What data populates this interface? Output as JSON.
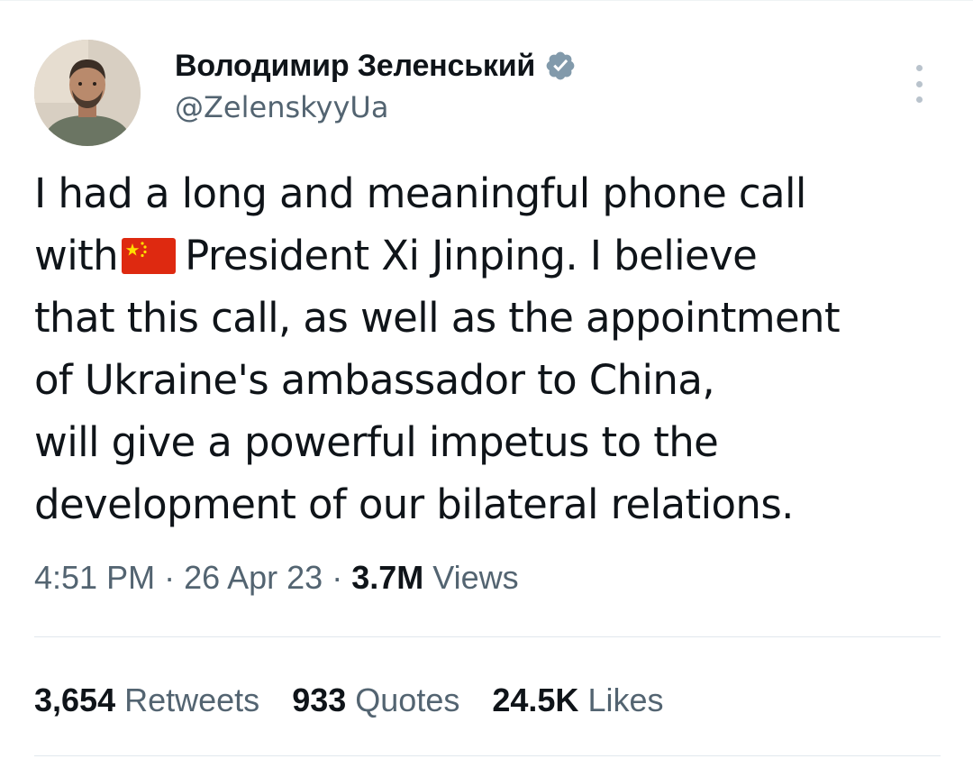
{
  "author": {
    "name": "Володимир Зеленський",
    "handle": "@ZelenskyyUa",
    "verified": true,
    "avatar_icon": "profile-photo",
    "verified_icon": "verified-badge-icon"
  },
  "menu": {
    "icon": "more-vertical-icon"
  },
  "tweet": {
    "lines": [
      {
        "text": "I had a long and meaningful phone call"
      },
      {
        "prefix": "with",
        "emoji": "china-flag",
        "suffix": "President Xi Jinping. I believe"
      },
      {
        "text": "that this call, as well as the appointment"
      },
      {
        "text": "of Ukraine's ambassador to China,"
      },
      {
        "text": "will give a powerful impetus to the"
      },
      {
        "text": "development of our bilateral relations."
      }
    ]
  },
  "meta": {
    "time": "4:51 PM",
    "date": "26 Apr 23",
    "separator": " · ",
    "views_count": "3.7M",
    "views_label": "Views"
  },
  "stats": {
    "retweets": {
      "count": "3,654",
      "label": "Retweets"
    },
    "quotes": {
      "count": "933",
      "label": "Quotes"
    },
    "likes": {
      "count": "24.5K",
      "label": "Likes"
    }
  },
  "colors": {
    "text": "#0f1419",
    "secondary": "#536471",
    "verified": "#829aab",
    "divider": "#e1e8ed",
    "flag_red": "#de2910",
    "flag_star": "#ffde00"
  }
}
